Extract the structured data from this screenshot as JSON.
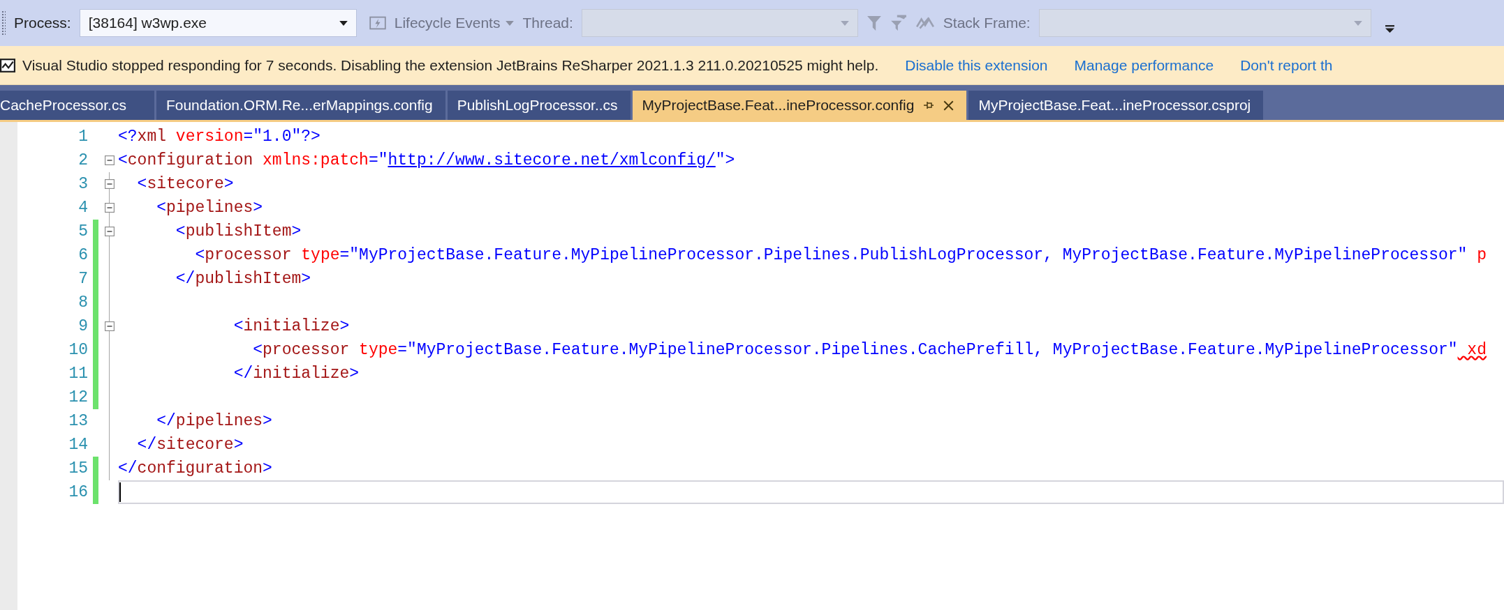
{
  "toolbar": {
    "process_label": "Process:",
    "process_value": "[38164] w3wp.exe",
    "lifecycle_events": {
      "label": "Lifecycle Events",
      "disabled": true
    },
    "thread_label": "Thread:",
    "thread_combo": {
      "disabled": true
    },
    "stack_frame_label": "Stack Frame:",
    "stack_frame_combo": {
      "disabled": true
    }
  },
  "infobar": {
    "message": "Visual Studio stopped responding for 7 seconds. Disabling the extension JetBrains ReSharper 2021.1.3 211.0.20210525 might help.",
    "links": [
      "Disable this extension",
      "Manage performance",
      "Don't report th"
    ]
  },
  "tabs": [
    {
      "label": "CacheProcessor.cs",
      "selected": false
    },
    {
      "label": "Foundation.ORM.Re...erMappings.config",
      "selected": false
    },
    {
      "label": "PublishLogProcessor..cs",
      "selected": false
    },
    {
      "label": "MyProjectBase.Feat...ineProcessor.config",
      "selected": true
    },
    {
      "label": "MyProjectBase.Feat...ineProcessor.csproj",
      "selected": false
    }
  ],
  "editor": {
    "lines": [
      {
        "number": "1",
        "changed": false,
        "fold": false,
        "current": false,
        "tokens": [
          {
            "kind": "punct",
            "text": "<?"
          },
          {
            "kind": "tag",
            "text": "xml"
          },
          {
            "kind": "attr",
            "text": " version"
          },
          {
            "kind": "punct",
            "text": "=\""
          },
          {
            "kind": "value",
            "text": "1.0"
          },
          {
            "kind": "punct",
            "text": "\"?>"
          }
        ]
      },
      {
        "number": "2",
        "changed": false,
        "fold": true,
        "current": false,
        "tokens": [
          {
            "kind": "punct",
            "text": "<"
          },
          {
            "kind": "tag",
            "text": "configuration"
          },
          {
            "kind": "attr",
            "text": " xmlns:patch"
          },
          {
            "kind": "punct",
            "text": "=\""
          },
          {
            "kind": "link",
            "text": "http://www.sitecore.net/xmlconfig/"
          },
          {
            "kind": "punct",
            "text": "\">"
          }
        ]
      },
      {
        "number": "3",
        "changed": false,
        "fold": true,
        "current": false,
        "tokens": [
          {
            "kind": "punct",
            "text": "  <"
          },
          {
            "kind": "tag",
            "text": "sitecore"
          },
          {
            "kind": "punct",
            "text": ">"
          }
        ]
      },
      {
        "number": "4",
        "changed": false,
        "fold": true,
        "current": false,
        "tokens": [
          {
            "kind": "punct",
            "text": "    <"
          },
          {
            "kind": "tag",
            "text": "pipelines"
          },
          {
            "kind": "punct",
            "text": ">"
          }
        ]
      },
      {
        "number": "5",
        "changed": true,
        "fold": true,
        "current": false,
        "tokens": [
          {
            "kind": "punct",
            "text": "      <"
          },
          {
            "kind": "tag",
            "text": "publishItem"
          },
          {
            "kind": "punct",
            "text": ">"
          }
        ]
      },
      {
        "number": "6",
        "changed": true,
        "fold": false,
        "current": false,
        "tokens": [
          {
            "kind": "punct",
            "text": "        <"
          },
          {
            "kind": "tag",
            "text": "processor"
          },
          {
            "kind": "attr",
            "text": " type"
          },
          {
            "kind": "punct",
            "text": "=\""
          },
          {
            "kind": "value",
            "text": "MyProjectBase.Feature.MyPipelineProcessor.Pipelines.PublishLogProcessor, MyProjectBase.Feature.MyPipelineProcessor"
          },
          {
            "kind": "punct",
            "text": "\""
          },
          {
            "kind": "attr",
            "text": " p"
          }
        ]
      },
      {
        "number": "7",
        "changed": true,
        "fold": false,
        "current": false,
        "tokens": [
          {
            "kind": "punct",
            "text": "      </"
          },
          {
            "kind": "tag",
            "text": "publishItem"
          },
          {
            "kind": "punct",
            "text": ">"
          }
        ]
      },
      {
        "number": "8",
        "changed": true,
        "fold": false,
        "current": false
      },
      {
        "number": "9",
        "changed": true,
        "fold": true,
        "current": false,
        "tokens": [
          {
            "kind": "punct",
            "text": "            <"
          },
          {
            "kind": "tag",
            "text": "initialize"
          },
          {
            "kind": "punct",
            "text": ">"
          }
        ]
      },
      {
        "number": "10",
        "changed": true,
        "fold": false,
        "current": false,
        "tokens": [
          {
            "kind": "punct",
            "text": "              <"
          },
          {
            "kind": "tag",
            "text": "processor"
          },
          {
            "kind": "attr",
            "text": " type"
          },
          {
            "kind": "punct",
            "text": "=\""
          },
          {
            "kind": "value",
            "text": "MyProjectBase.Feature.MyPipelineProcessor.Pipelines.CachePrefill, MyProjectBase.Feature.MyPipelineProcessor"
          },
          {
            "kind": "punct",
            "text": "\""
          },
          {
            "kind": "error",
            "text": " xd"
          }
        ]
      },
      {
        "number": "11",
        "changed": true,
        "fold": false,
        "current": false,
        "tokens": [
          {
            "kind": "punct",
            "text": "            </"
          },
          {
            "kind": "tag",
            "text": "initialize"
          },
          {
            "kind": "punct",
            "text": ">"
          }
        ]
      },
      {
        "number": "12",
        "changed": true,
        "fold": false,
        "current": false
      },
      {
        "number": "13",
        "changed": false,
        "fold": false,
        "current": false,
        "tokens": [
          {
            "kind": "punct",
            "text": "    </"
          },
          {
            "kind": "tag",
            "text": "pipelines"
          },
          {
            "kind": "punct",
            "text": ">"
          }
        ]
      },
      {
        "number": "14",
        "changed": false,
        "fold": false,
        "current": false,
        "tokens": [
          {
            "kind": "punct",
            "text": "  </"
          },
          {
            "kind": "tag",
            "text": "sitecore"
          },
          {
            "kind": "punct",
            "text": ">"
          }
        ]
      },
      {
        "number": "15",
        "changed": true,
        "fold": false,
        "current": false,
        "tokens": [
          {
            "kind": "punct",
            "text": "</"
          },
          {
            "kind": "tag",
            "text": "configuration"
          },
          {
            "kind": "punct",
            "text": ">"
          }
        ]
      },
      {
        "number": "16",
        "changed": true,
        "fold": false,
        "current": true
      }
    ]
  }
}
